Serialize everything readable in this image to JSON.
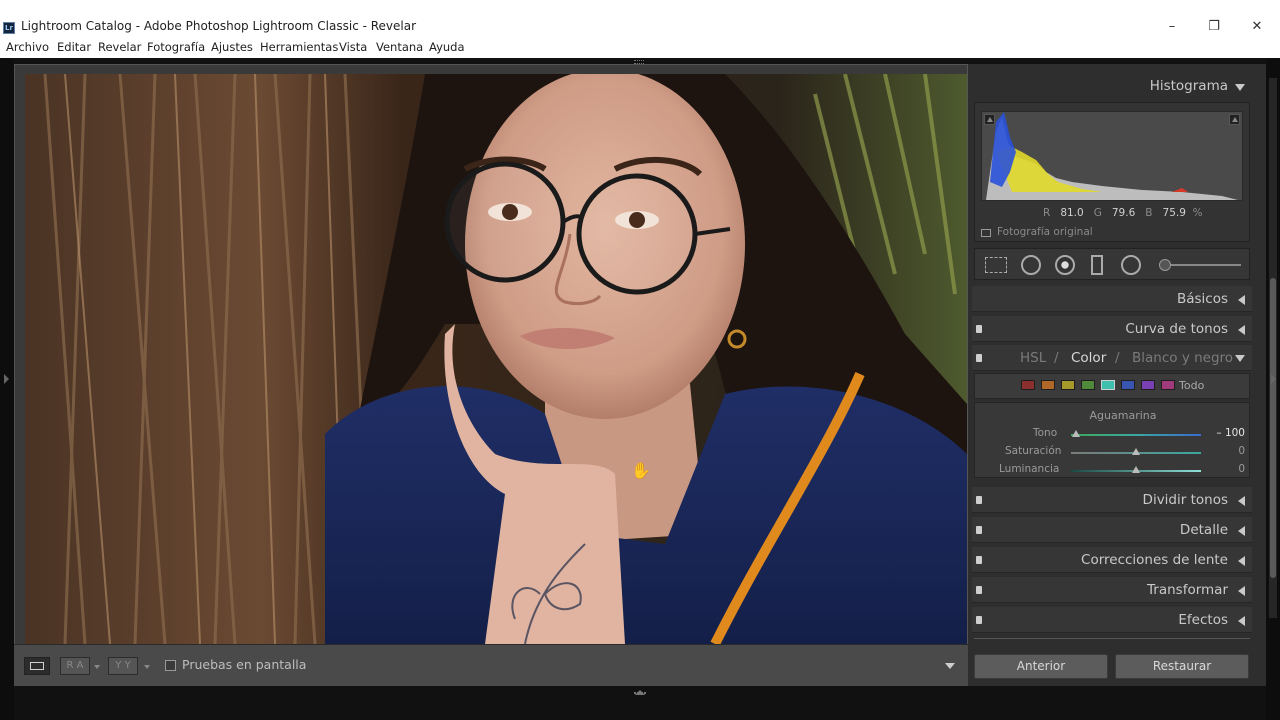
{
  "window": {
    "title": "Lightroom Catalog - Adobe Photoshop Lightroom Classic - Revelar",
    "logo_text": "Lr",
    "controls": {
      "minimize": "–",
      "restore": "❐",
      "close": "✕"
    }
  },
  "menu": [
    "Archivo",
    "Editar",
    "Revelar",
    "Fotografía",
    "Ajustes",
    "Herramientas",
    "Vista",
    "Ventana",
    "Ayuda"
  ],
  "histogram": {
    "title": "Histograma",
    "readout": {
      "r_label": "R",
      "r": "81.0",
      "g_label": "G",
      "g": "79.6",
      "b_label": "B",
      "b": "75.9",
      "unit": "%"
    },
    "original_photo_label": "Fotografía original"
  },
  "panels": {
    "basicos": "Básicos",
    "curva": "Curva de tonos",
    "hsl": {
      "hsl": "HSL",
      "sep": "/",
      "color": "Color",
      "bw": "Blanco y negro",
      "active": "Color"
    },
    "dividir": "Dividir tonos",
    "detalle": "Detalle",
    "correcciones": "Correcciones de lente",
    "transformar": "Transformar",
    "efectos": "Efectos"
  },
  "color_panel": {
    "swatches": [
      "#8b2e2e",
      "#b0672a",
      "#a59a2a",
      "#4f8a3a",
      "#3fbfae",
      "#3a55b0",
      "#7a3fb0",
      "#a03a7a"
    ],
    "all_label": "Todo",
    "selected_color": "Aguamarina",
    "sliders": [
      {
        "label": "Tono",
        "value": "– 100",
        "position": 0.0
      },
      {
        "label": "Saturación",
        "value": "0",
        "position": 0.5
      },
      {
        "label": "Luminancia",
        "value": "0",
        "position": 0.5
      }
    ]
  },
  "toolbar": {
    "softproof_label": "Pruebas en pantalla",
    "view_ra": "R A",
    "view_yy": "Y Y"
  },
  "buttons": {
    "previous": "Anterior",
    "reset": "Restaurar"
  }
}
